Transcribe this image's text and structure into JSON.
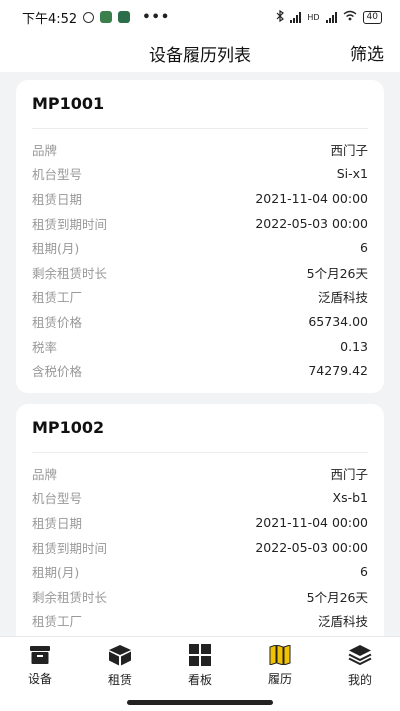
{
  "status_bar": {
    "time": "下午4:52",
    "overflow": "•••",
    "network": "HD",
    "battery": "40"
  },
  "header": {
    "title": "设备履历列表",
    "filter_label": "筛选"
  },
  "cards": [
    {
      "id": "MP1001",
      "rows": [
        {
          "label": "品牌",
          "value": "西门子"
        },
        {
          "label": "机台型号",
          "value": "Si-x1"
        },
        {
          "label": "租赁日期",
          "value": "2021-11-04 00:00"
        },
        {
          "label": "租赁到期时间",
          "value": "2022-05-03 00:00"
        },
        {
          "label": "租期(月)",
          "value": "6"
        },
        {
          "label": "剩余租赁时长",
          "value": "5个月26天"
        },
        {
          "label": "租赁工厂",
          "value": "泛盾科技"
        },
        {
          "label": "租赁价格",
          "value": "65734.00"
        },
        {
          "label": "税率",
          "value": "0.13"
        },
        {
          "label": "含税价格",
          "value": "74279.42"
        }
      ]
    },
    {
      "id": "MP1002",
      "rows": [
        {
          "label": "品牌",
          "value": "西门子"
        },
        {
          "label": "机台型号",
          "value": "Xs-b1"
        },
        {
          "label": "租赁日期",
          "value": "2021-11-04 00:00"
        },
        {
          "label": "租赁到期时间",
          "value": "2022-05-03 00:00"
        },
        {
          "label": "租期(月)",
          "value": "6"
        },
        {
          "label": "剩余租赁时长",
          "value": "5个月26天"
        },
        {
          "label": "租赁工厂",
          "value": "泛盾科技"
        }
      ]
    }
  ],
  "tabbar": {
    "active_color": "#f2c200",
    "items": [
      {
        "label": "设备",
        "icon": "archive-box-icon"
      },
      {
        "label": "租赁",
        "icon": "cube-icon"
      },
      {
        "label": "看板",
        "icon": "grid-icon"
      },
      {
        "label": "履历",
        "icon": "map-icon",
        "active": true
      },
      {
        "label": "我的",
        "icon": "layers-icon"
      }
    ]
  }
}
